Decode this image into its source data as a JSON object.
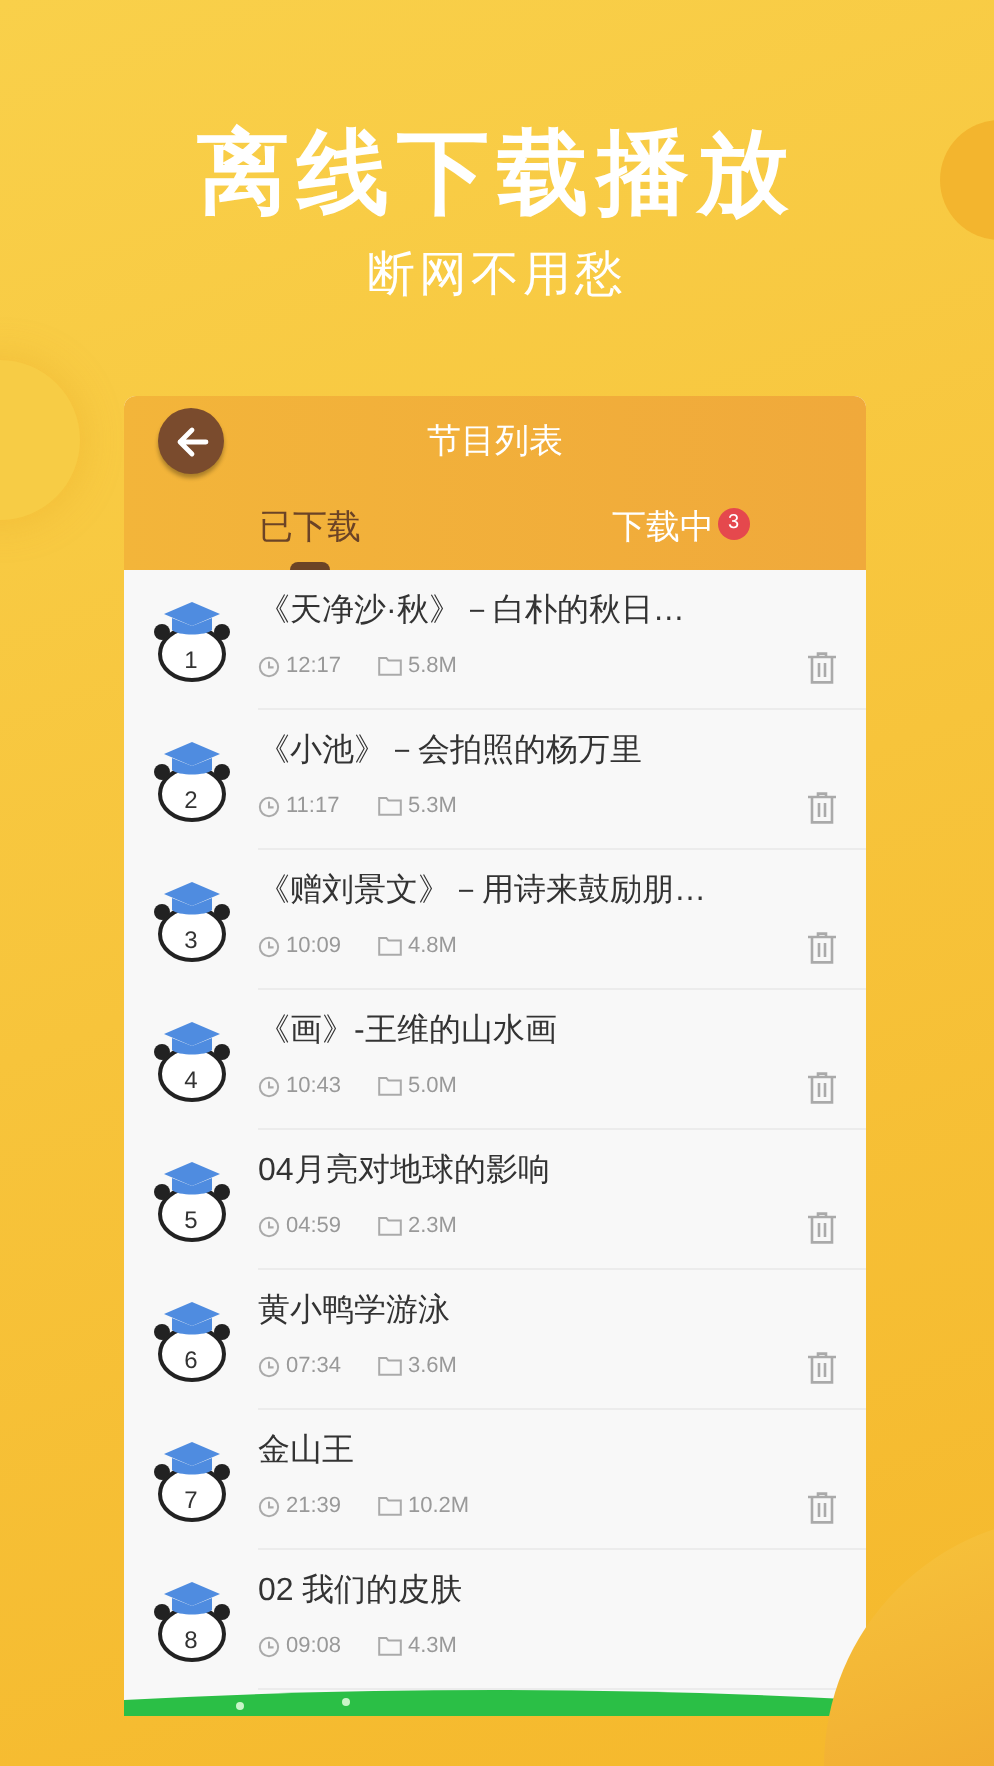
{
  "headline": "离线下载播放",
  "subheadline": "断网不用愁",
  "header": {
    "title": "节目列表"
  },
  "tabs": [
    {
      "label": "已下载",
      "selected": true
    },
    {
      "label": "下载中",
      "selected": false,
      "badge": "3"
    }
  ],
  "episodes": [
    {
      "number": "1",
      "title": "《天净沙·秋》－白朴的秋日…",
      "duration": "12:17",
      "size": "5.8M",
      "delete_visible": true
    },
    {
      "number": "2",
      "title": "《小池》－会拍照的杨万里",
      "duration": "11:17",
      "size": "5.3M",
      "delete_visible": true
    },
    {
      "number": "3",
      "title": "《赠刘景文》－用诗来鼓励朋…",
      "duration": "10:09",
      "size": "4.8M",
      "delete_visible": true
    },
    {
      "number": "4",
      "title": "《画》-王维的山水画",
      "duration": "10:43",
      "size": "5.0M",
      "delete_visible": true
    },
    {
      "number": "5",
      "title": "04月亮对地球的影响",
      "duration": "04:59",
      "size": "2.3M",
      "delete_visible": true
    },
    {
      "number": "6",
      "title": "黄小鸭学游泳",
      "duration": "07:34",
      "size": "3.6M",
      "delete_visible": true
    },
    {
      "number": "7",
      "title": "金山王",
      "duration": "21:39",
      "size": "10.2M",
      "delete_visible": true
    },
    {
      "number": "8",
      "title": "02 我们的皮肤",
      "duration": "09:08",
      "size": "4.3M",
      "delete_visible": false
    }
  ]
}
